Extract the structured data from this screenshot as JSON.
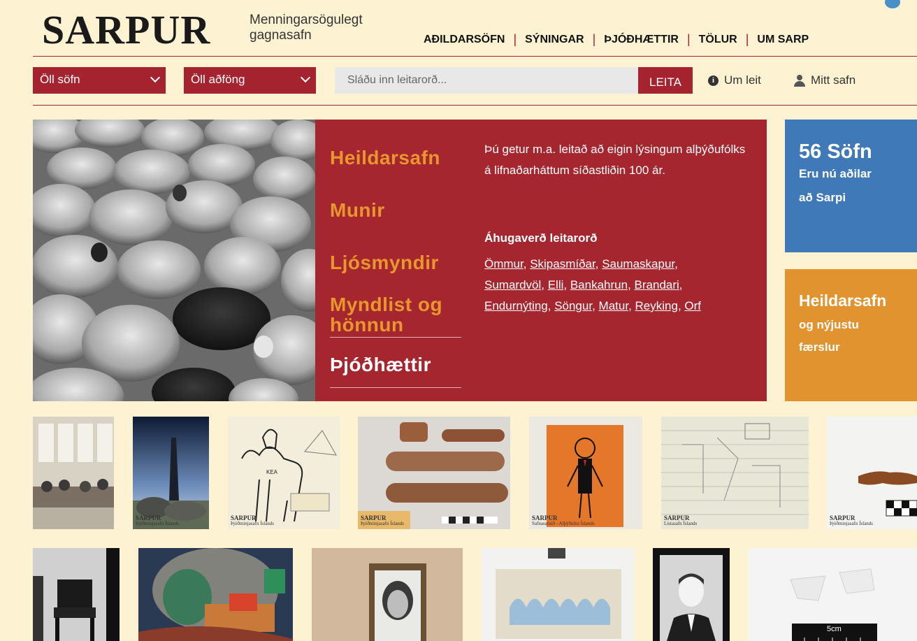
{
  "header": {
    "logo": "SARPUR",
    "tagline_line1": "Menningarsögulegt",
    "tagline_line2": "gagnasafn",
    "nav": [
      "AÐILDARSÖFN",
      "SÝNINGAR",
      "ÞJÓÐHÆTTIR",
      "TÖLUR",
      "UM SARP"
    ],
    "nav_separator": "|"
  },
  "search": {
    "museum_select": "Öll söfn",
    "type_select": "Öll aðföng",
    "placeholder": "Sláðu inn leitarorð...",
    "value": "",
    "button": "LEITA",
    "help_link": "Um leit",
    "my_collection": "Mitt safn"
  },
  "hero": {
    "categories": [
      {
        "label": "Heildarsafn",
        "active": false
      },
      {
        "label": "Munir",
        "active": false
      },
      {
        "label": "Ljósmyndir",
        "active": false
      },
      {
        "label": "Myndlist og hönnun",
        "active": false
      },
      {
        "label": "Þjóðhættir",
        "active": true
      }
    ],
    "intro": "Þú getur m.a. leitað að eigin lýsingum alþýðufólks á lifnaðarháttum síðastliðin 100 ár.",
    "keywords_heading": "Áhugaverð leitarorð",
    "keywords": [
      "Ömmur",
      "Skipasmíðar",
      "Saumaskapur",
      "Sumardvöl",
      "Elli",
      "Bankahrun",
      "Brandari",
      "Endurnýting",
      "Söngur",
      "Matur",
      "Reyking",
      "Orf"
    ],
    "keyword_separator": ", "
  },
  "side_boxes": {
    "members": {
      "big": "56 Söfn",
      "line1": "Eru nú aðilar",
      "line2": "að Sarpi"
    },
    "all": {
      "big": "Heildarsafn",
      "line1": "og nýjustu",
      "line2": "færslur"
    }
  },
  "watermarks": {
    "brand": "SARPUR",
    "national_museum": "Þjóðminjasafn Íslands",
    "arts_museum": "Listasafn Íslands",
    "collection_museum": "Safnasafnið - Alþýðulist Íslands",
    "scale_label": "5cm"
  },
  "colors": {
    "brand_red": "#a5232f",
    "accent_orange": "#e8962e",
    "blue_box": "#3f79b7",
    "orange_box": "#e0932e",
    "background": "#fdf3d3"
  }
}
